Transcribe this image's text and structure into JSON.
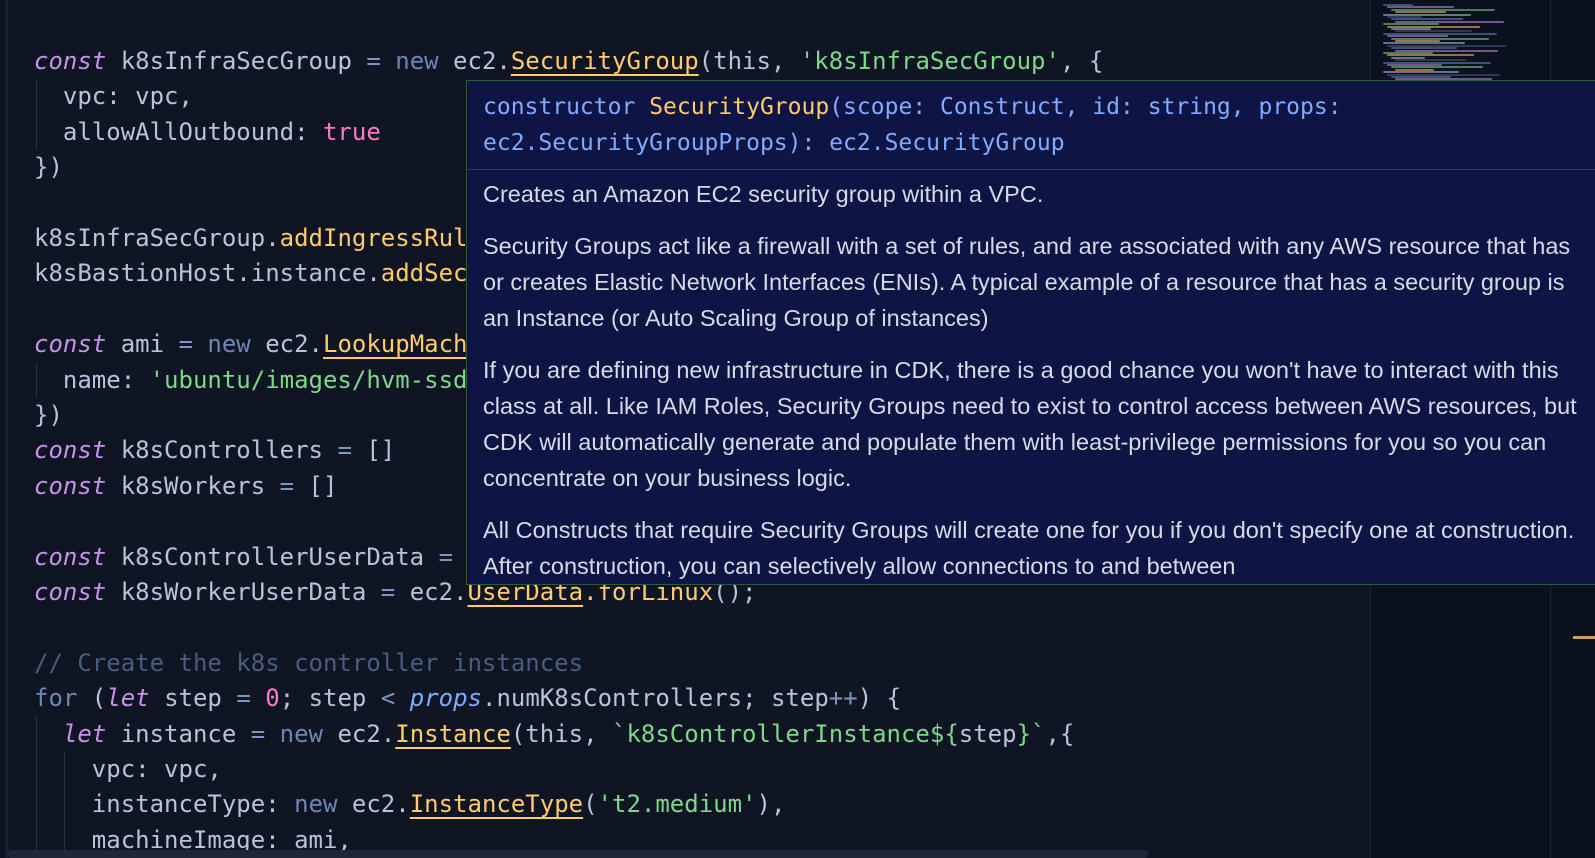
{
  "code": {
    "lines": [
      {
        "tokens": [
          [
            "kw-i",
            "const"
          ],
          [
            "ident",
            " k8sInfraSecGroup "
          ],
          [
            "op",
            "="
          ],
          [
            "kw",
            " new"
          ],
          [
            "ident",
            " ec2."
          ],
          [
            "cls",
            "SecurityGroup"
          ],
          [
            "ident",
            "(this, "
          ],
          [
            "str",
            "'k8sInfraSecGroup'"
          ],
          [
            "ident",
            ", {"
          ]
        ]
      },
      {
        "tokens": [
          [
            "ident",
            "  vpc: vpc,"
          ]
        ]
      },
      {
        "tokens": [
          [
            "ident",
            "  allowAllOutbound: "
          ],
          [
            "bool",
            "true"
          ]
        ]
      },
      {
        "tokens": [
          [
            "ident",
            "})"
          ]
        ]
      },
      {
        "tokens": []
      },
      {
        "tokens": [
          [
            "ident",
            "k8sInfraSecGroup."
          ],
          [
            "fn",
            "addIngressRul"
          ]
        ]
      },
      {
        "tokens": [
          [
            "ident",
            "k8sBastionHost.instance."
          ],
          [
            "fn",
            "addSec"
          ]
        ]
      },
      {
        "tokens": []
      },
      {
        "tokens": [
          [
            "kw-i",
            "const"
          ],
          [
            "ident",
            " ami "
          ],
          [
            "op",
            "="
          ],
          [
            "kw",
            " new"
          ],
          [
            "ident",
            " ec2."
          ],
          [
            "cls",
            "LookupMach"
          ]
        ]
      },
      {
        "tokens": [
          [
            "ident",
            "  name: "
          ],
          [
            "str",
            "'ubuntu/images/hvm-ssd"
          ]
        ]
      },
      {
        "tokens": [
          [
            "ident",
            "})"
          ]
        ]
      },
      {
        "tokens": [
          [
            "kw-i",
            "const"
          ],
          [
            "ident",
            " k8sControllers "
          ],
          [
            "op",
            "="
          ],
          [
            "ident",
            " []"
          ]
        ]
      },
      {
        "tokens": [
          [
            "kw-i",
            "const"
          ],
          [
            "ident",
            " k8sWorkers "
          ],
          [
            "op",
            "="
          ],
          [
            "ident",
            " []"
          ]
        ]
      },
      {
        "tokens": []
      },
      {
        "tokens": [
          [
            "kw-i",
            "const"
          ],
          [
            "ident",
            " k8sControllerUserData "
          ],
          [
            "op",
            "="
          ]
        ]
      },
      {
        "tokens": [
          [
            "kw-i",
            "const"
          ],
          [
            "ident",
            " k8sWorkerUserData "
          ],
          [
            "op",
            "="
          ],
          [
            "ident",
            " ec2."
          ],
          [
            "cls",
            "UserData"
          ],
          [
            "fn",
            ".forLinux"
          ],
          [
            "ident",
            "();"
          ]
        ]
      },
      {
        "tokens": []
      },
      {
        "tokens": [
          [
            "comment",
            "// Create the k8s controller instances"
          ]
        ]
      },
      {
        "tokens": [
          [
            "kw",
            "for"
          ],
          [
            "ident",
            " ("
          ],
          [
            "kw-i",
            "let"
          ],
          [
            "ident",
            " step "
          ],
          [
            "op",
            "="
          ],
          [
            "num",
            " 0"
          ],
          [
            "ident",
            "; step "
          ],
          [
            "op",
            "<"
          ],
          [
            "prop-i",
            " props"
          ],
          [
            "ident",
            ".numK8sControllers; step"
          ],
          [
            "op",
            "++"
          ],
          [
            "ident",
            ") {"
          ]
        ]
      },
      {
        "tokens": [
          [
            "kw-i",
            "  let"
          ],
          [
            "ident",
            " instance "
          ],
          [
            "op",
            "="
          ],
          [
            "kw",
            " new"
          ],
          [
            "ident",
            " ec2."
          ],
          [
            "cls",
            "Instance"
          ],
          [
            "ident",
            "(this, "
          ],
          [
            "str",
            "`k8sControllerInstance${"
          ],
          [
            "ident",
            "step"
          ],
          [
            "str",
            "}`"
          ],
          [
            "ident",
            ",{"
          ]
        ]
      },
      {
        "tokens": [
          [
            "ident",
            "    vpc: vpc,"
          ]
        ]
      },
      {
        "tokens": [
          [
            "ident",
            "    instanceType: "
          ],
          [
            "kw",
            "new"
          ],
          [
            "ident",
            " ec2."
          ],
          [
            "cls",
            "InstanceType"
          ],
          [
            "ident",
            "("
          ],
          [
            "str",
            "'t2.medium'"
          ],
          [
            "ident",
            "),"
          ]
        ]
      },
      {
        "tokens": [
          [
            "ident",
            "    machineImage: ami,"
          ]
        ]
      }
    ]
  },
  "hover": {
    "signature_keyword": "constructor",
    "signature_name": "SecurityGroup",
    "signature_rest_1": "(scope: Construct, id: string, props:",
    "signature_rest_2": "ec2.SecurityGroupProps): ec2.SecurityGroup",
    "paragraphs": [
      "Creates an Amazon EC2 security group within a VPC.",
      "Security Groups act like a firewall with a set of rules, and are associated with any AWS resource that has or creates Elastic Network Interfaces (ENIs). A typical example of a resource that has a security group is an Instance (or Auto Scaling Group of instances)",
      "If you are defining new infrastructure in CDK, there is a good chance you won't have to interact with this class at all. Like IAM Roles, Security Groups need to exist to control access between AWS resources, but CDK will automatically generate and populate them with least-privilege permissions for you so you can concentrate on your business logic.",
      "All Constructs that require Security Groups will create one for you if you don't specify one at construction. After construction, you can selectively allow connections to and between"
    ]
  },
  "colors": {
    "background": "#0f1523",
    "hover_background": "#0e1443",
    "accent": "#ffcb6b"
  }
}
